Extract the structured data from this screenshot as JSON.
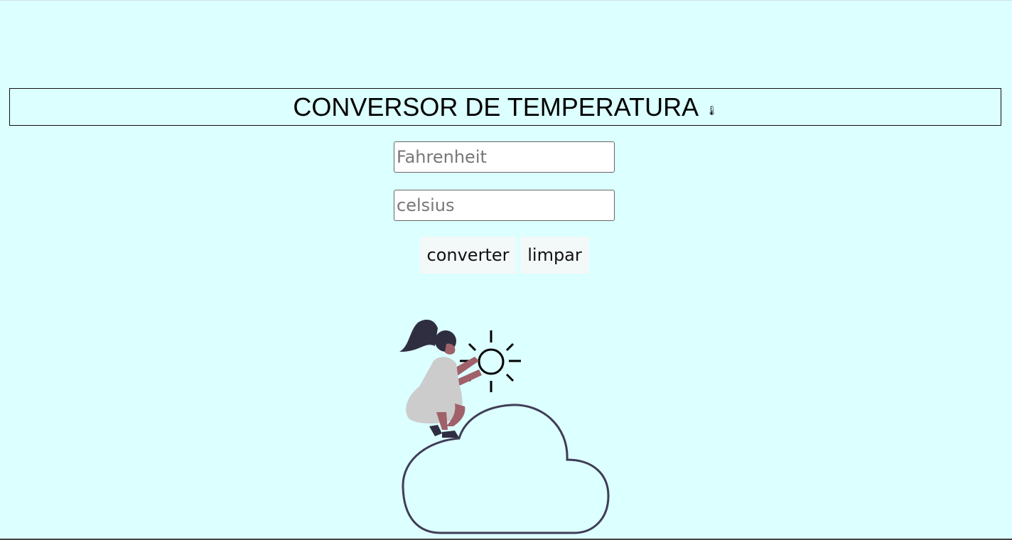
{
  "header": {
    "title": "CONVERSOR DE TEMPERATURA",
    "title_icon": "🌡"
  },
  "form": {
    "fahrenheit": {
      "value": "",
      "placeholder": "Fahrenheit"
    },
    "celsius": {
      "value": "",
      "placeholder": "celsius"
    },
    "convert_label": "converter",
    "clear_label": "limpar"
  },
  "illustration": {
    "icon": "woman-adjusting-sun-on-cloud-illustration"
  },
  "colors": {
    "background": "#dcffff",
    "hair": "#2f2e41",
    "skin": "#a0616a",
    "dress": "#cccccc",
    "outline": "#3f3d56"
  }
}
